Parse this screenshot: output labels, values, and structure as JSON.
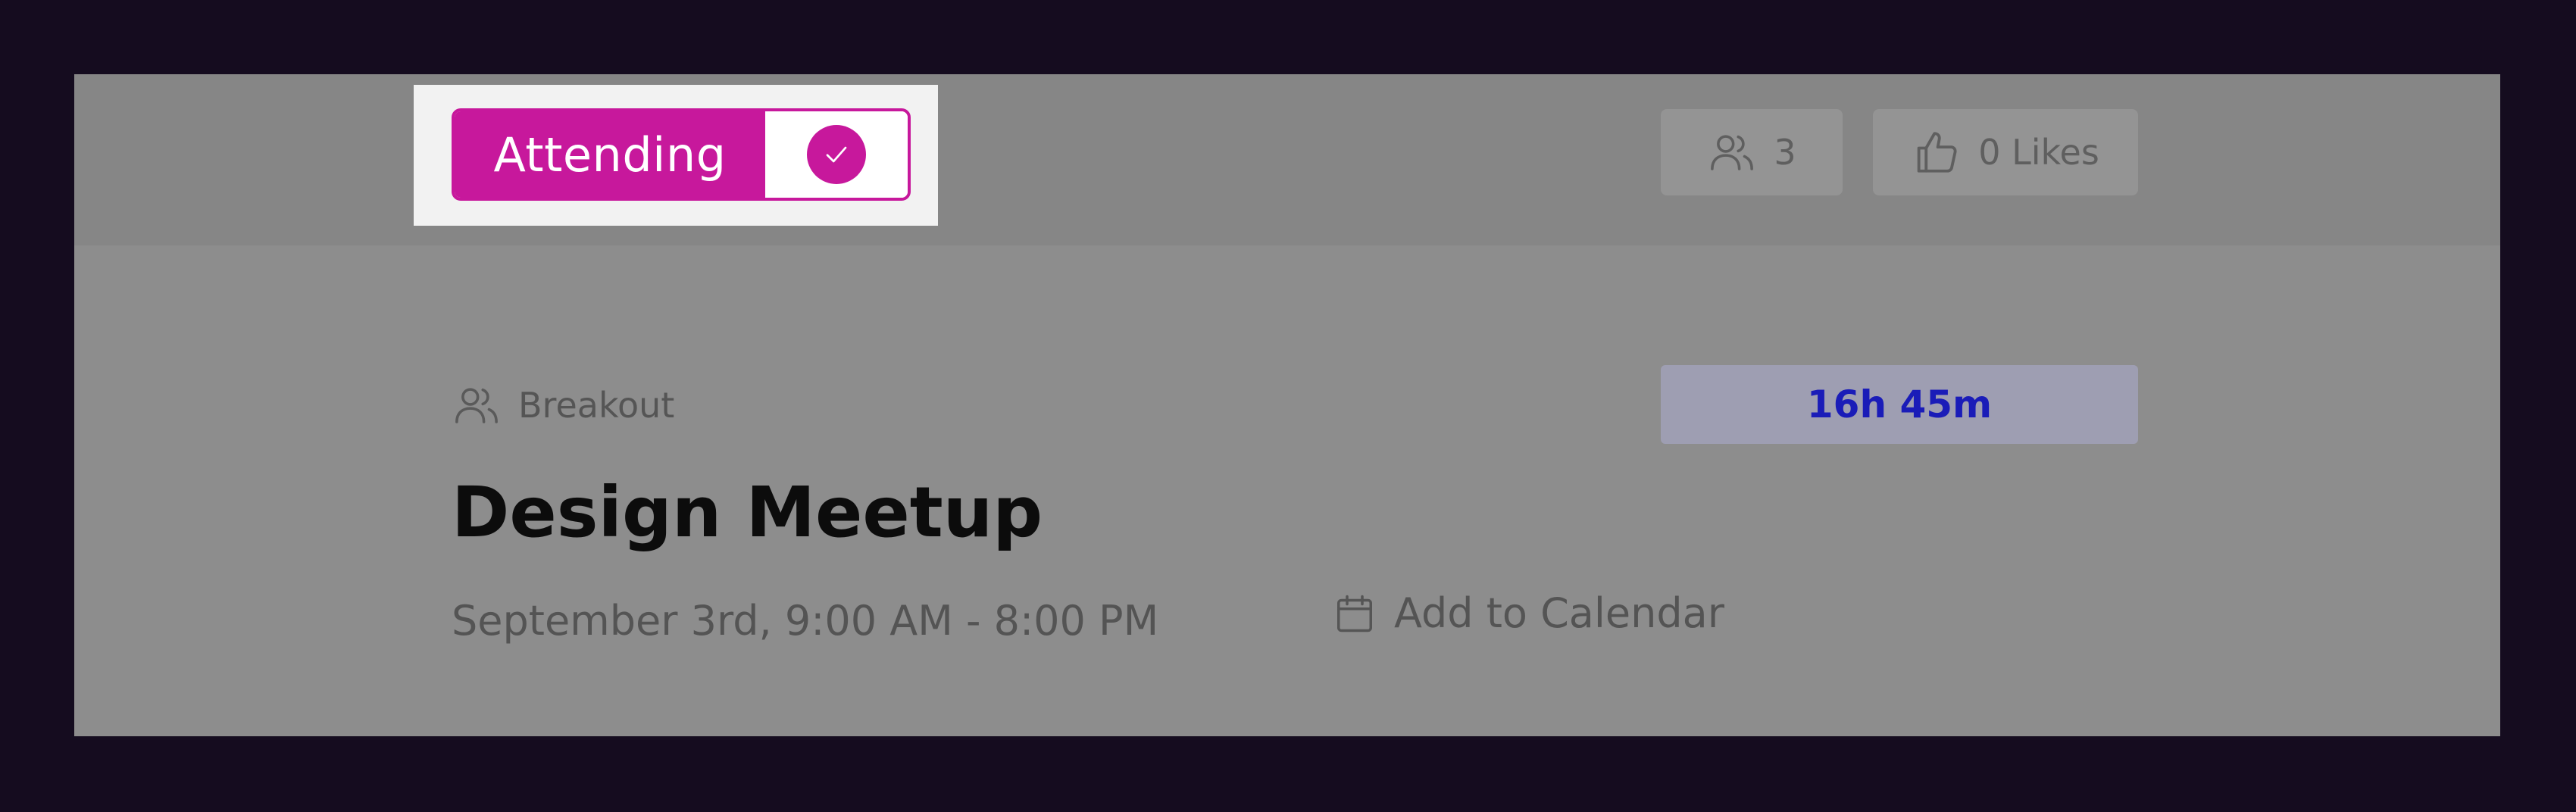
{
  "header": {
    "attend_button": {
      "label": "Attending",
      "state": "checked",
      "icon": "check-icon",
      "accent_color": "#c7189c"
    },
    "attendees": {
      "icon": "users-icon",
      "count": "3"
    },
    "likes": {
      "icon": "thumbs-up-icon",
      "label": "0 Likes"
    }
  },
  "event": {
    "type_icon": "users-icon",
    "type": "Breakout",
    "countdown": "16h 45m",
    "countdown_color": "#1a1cb8",
    "title": "Design Meetup",
    "datetime": "September 3rd, 9:00 AM - 8:00 PM",
    "calendar": {
      "icon": "calendar-icon",
      "label": "Add to Calendar"
    }
  }
}
